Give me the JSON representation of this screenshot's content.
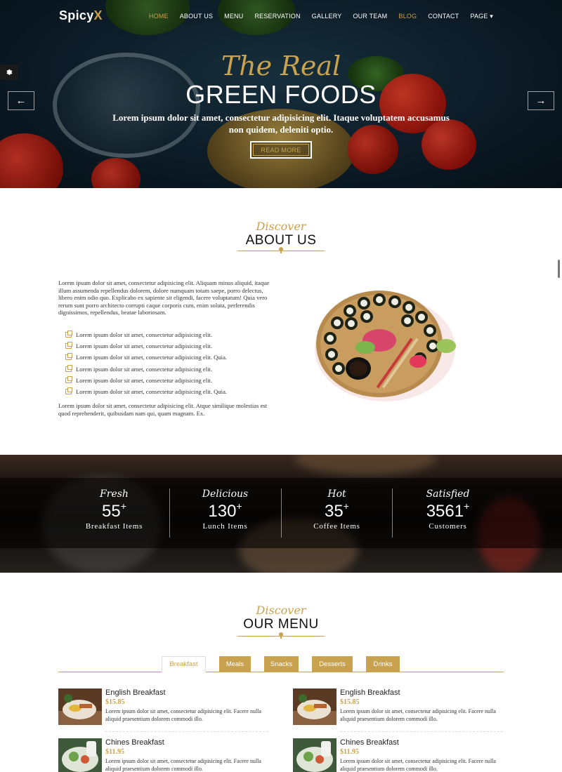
{
  "brand": {
    "name_main": "Spicy",
    "name_accent": "X"
  },
  "nav": {
    "items": [
      "HOME",
      "ABOUT US",
      "MENU",
      "RESERVATION",
      "GALLERY",
      "OUR TEAM",
      "BLOG",
      "CONTACT",
      "PAGE ▾"
    ]
  },
  "hero": {
    "script": "The Real",
    "title": "GREEN FOODS",
    "subtitle": "Lorem ipsum dolor sit amet, consectetur adipisicing elit. Itaque voluptatem accusamus non quidem, deleniti optio.",
    "button": "READ MORE",
    "prev_arrow": "←",
    "next_arrow": "→"
  },
  "about": {
    "discover": "Discover",
    "title": "ABOUT US",
    "intro": "Lorem ipsum dolor sit amet, consectetur adipisicing elit. Aliquam minus aliquid, itaque illum assumenda repellendus dolorem, dolore numquam totam saepe, porro delectus, libero enim odio quo. Explicabo ex sapiente sit eligendi, facere voluptatum! Quia vero rerum sunt porro architecto corrupti caque corporis cum, enim soluta, perferendis dignissimos, repellendus, beatae laboriosam.",
    "list": [
      "Lorem ipsum dolor sit amet, consectetur adipisicing elit.",
      "Lorem ipsum dolor sit amet, consectetur adipisicing elit.",
      "Lorem ipsum dolor sit amet, consectetur adipisicing elit. Quia.",
      "Lorem ipsum dolor sit amet, consectetur adipisicing elit.",
      "Lorem ipsum dolor sit amet, consectetur adipisicing elit.",
      "Lorem ipsum dolor sit amet, consectetur adipisicing elit. Quia."
    ],
    "outro": "Lorem ipsum dolor sit amet, consectetur adipisicing elit. Atque similique molestias est quod reprehenderit, quibusdam nam qui, quam magnam. Ex."
  },
  "stats": [
    {
      "script": "Fresh",
      "value": "55",
      "plus": "+",
      "label": "Breakfast Items"
    },
    {
      "script": "Delicious",
      "value": "130",
      "plus": "+",
      "label": "Lunch Items"
    },
    {
      "script": "Hot",
      "value": "35",
      "plus": "+",
      "label": "Coffee Items"
    },
    {
      "script": "Satisfied",
      "value": "3561",
      "plus": "+",
      "label": "Customers"
    }
  ],
  "menu": {
    "discover": "Discover",
    "title": "OUR MENU",
    "tabs": [
      "Breakfast",
      "Meals",
      "Snacks",
      "Desserts",
      "Drinks"
    ],
    "items": [
      {
        "name": "English Breakfast",
        "price": "$15.85",
        "desc": "Lorem ipsum dolor sit amet, consectetur adipisicing elit. Facere nulla aliquid praesentium dolorem commodi illo."
      },
      {
        "name": "English Breakfast",
        "price": "$15.85",
        "desc": "Lorem ipsum dolor sit amet, consectetur adipisicing elit. Facere nulla aliquid praesentium dolorem commodi illo."
      },
      {
        "name": "Chines Breakfast",
        "price": "$11.95",
        "desc": "Lorem ipsum dolor sit amet, consectetur adipisicing elit. Facere nulla aliquid praesentium dolorem commodi illo."
      },
      {
        "name": "Chines Breakfast",
        "price": "$11.95",
        "desc": "Lorem ipsum dolor sit amet, consectetur adipisicing elit. Facere nulla aliquid praesentium dolorem commodi illo."
      }
    ]
  },
  "colors": {
    "accent": "#c8a24f",
    "dark": "#111111"
  }
}
